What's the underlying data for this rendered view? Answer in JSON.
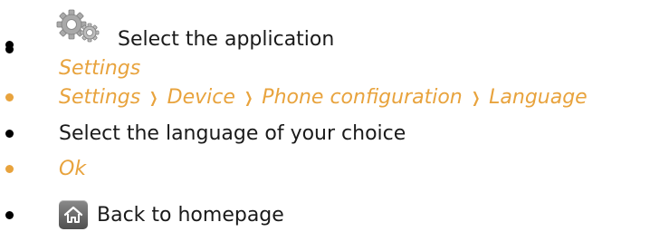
{
  "steps": [
    {
      "icon": "settings-gears-icon",
      "text": "Select the application",
      "subtext": "Settings"
    },
    {
      "path": [
        "Settings",
        "Device",
        "Phone configuration",
        "Language"
      ],
      "separator": "❯"
    },
    {
      "text": "Select the language of your choice"
    },
    {
      "text": "Ok"
    },
    {
      "icon": "home-icon",
      "text": "Back to homepage"
    }
  ],
  "colors": {
    "accent": "#e8a33d",
    "text": "#1a1a1a",
    "bullet": "#000000"
  }
}
